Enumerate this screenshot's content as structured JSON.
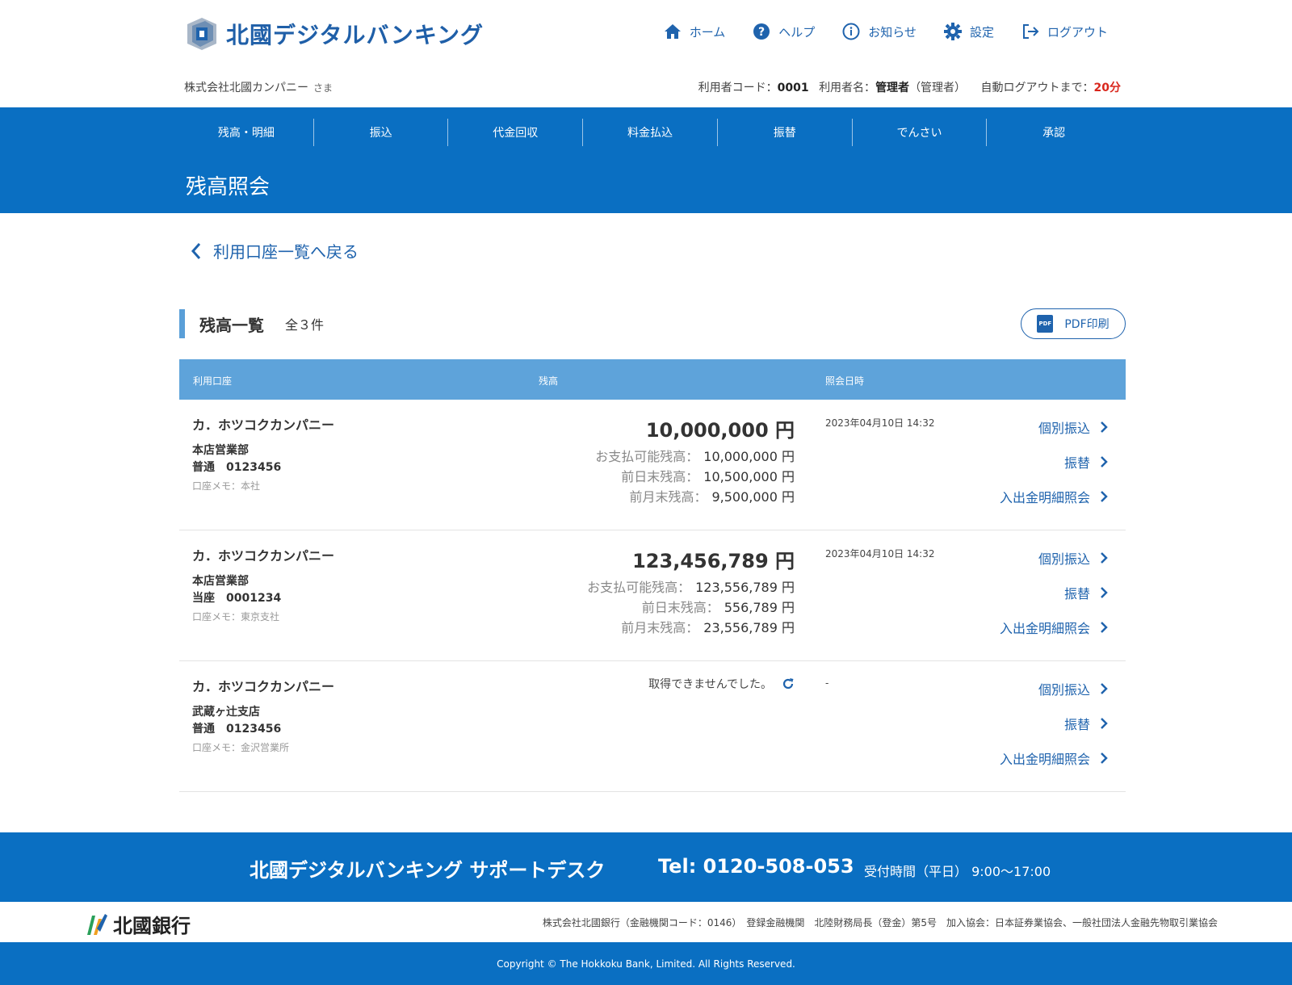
{
  "header": {
    "logo_text": "北國デジタルバンキング",
    "nav": [
      {
        "label": "ホーム",
        "icon": "home-icon"
      },
      {
        "label": "ヘルプ",
        "icon": "help-icon"
      },
      {
        "label": "お知らせ",
        "icon": "info-icon"
      },
      {
        "label": "設定",
        "icon": "gear-icon"
      },
      {
        "label": "ログアウト",
        "icon": "logout-icon"
      }
    ],
    "company": "株式会社北國カンパニー",
    "honorific": "さま",
    "user_code_label": "利用者コード：",
    "user_code": "0001",
    "user_name_label": "利用者名：",
    "user_name": "管理者",
    "user_role": "（管理者）",
    "auto_logout_label": "自動ログアウトまで：",
    "auto_logout_value": "20分"
  },
  "menu": [
    "残高・明細",
    "振込",
    "代金回収",
    "料金払込",
    "振替",
    "でんさい",
    "承認"
  ],
  "page_title": "残高照会",
  "back_link": "利用口座一覧へ戻る",
  "section": {
    "title": "残高一覧",
    "count": "全３件",
    "pdf_label": "PDF印刷",
    "pdf_icon_text": "PDF"
  },
  "table": {
    "headers": {
      "account": "利用口座",
      "balance": "残高",
      "datetime": "照会日時"
    },
    "rows": [
      {
        "name": "カ．ホツコクカンパニー",
        "branch": "本店営業部",
        "account": "普通　0123456",
        "memo": "口座メモ：本社",
        "balance": "10,000,000 円",
        "available": {
          "label": "お支払可能残高：",
          "value": "10,000,000 円"
        },
        "prev_day": {
          "label": "前日末残高：",
          "value": "10,500,000 円"
        },
        "prev_month": {
          "label": "前月末残高：",
          "value": "9,500,000 円"
        },
        "datetime": "2023年04月10日 14:32",
        "actions": [
          "個別振込",
          "振替",
          "入出金明細照会"
        ]
      },
      {
        "name": "カ．ホツコクカンパニー",
        "branch": "本店営業部",
        "account": "当座　0001234",
        "memo": "口座メモ：東京支社",
        "balance": "123,456,789 円",
        "available": {
          "label": "お支払可能残高：",
          "value": "123,556,789 円"
        },
        "prev_day": {
          "label": "前日末残高：",
          "value": "556,789 円"
        },
        "prev_month": {
          "label": "前月末残高：",
          "value": "23,556,789 円"
        },
        "datetime": "2023年04月10日 14:32",
        "actions": [
          "個別振込",
          "振替",
          "入出金明細照会"
        ]
      },
      {
        "name": "カ．ホツコクカンパニー",
        "branch": "武蔵ヶ辻支店",
        "account": "普通　0123456",
        "memo": "口座メモ：金沢営業所",
        "error": "取得できませんでした。",
        "datetime": "-",
        "actions": [
          "個別振込",
          "振替",
          "入出金明細照会"
        ]
      }
    ]
  },
  "footer": {
    "support_name": "北國デジタルバンキング サポートデスク",
    "tel": "Tel: 0120-508-053",
    "hours": "受付時間（平日） 9:00～17:00",
    "bank_name": "北國銀行",
    "legal": "株式会社北國銀行（金融機関コード：0146）　登録金融機関　北陸財務局長（登金）第5号　加入協会：日本証券業協会、一般社団法人金融先物取引業協会",
    "copyright": "Copyright © The Hokkoku Bank, Limited. All Rights Reserved."
  },
  "colors": {
    "brand_blue": "#0a6fc2",
    "table_header": "#5ea3da",
    "link": "#1f63ad",
    "alert_red": "#d9261c"
  }
}
